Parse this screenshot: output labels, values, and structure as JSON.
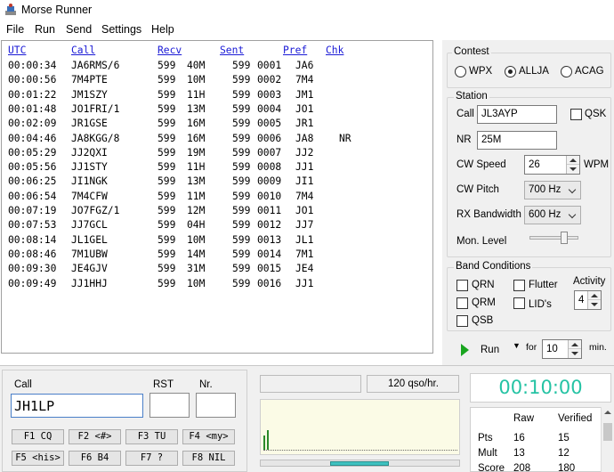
{
  "window": {
    "title": "Morse Runner"
  },
  "menu": [
    "File",
    "Run",
    "Send",
    "Settings",
    "Help"
  ],
  "log": {
    "columns": [
      "UTC",
      "Call",
      "Recv",
      "Sent",
      "Pref",
      "Chk"
    ],
    "rows": [
      {
        "utc": "00:00:34",
        "call": "JA6RMS/6",
        "rst": "599",
        "nr_recv": "40M",
        "rst_sent": "599",
        "nr_sent": "0001",
        "pref": "JA6",
        "chk": ""
      },
      {
        "utc": "00:00:56",
        "call": "7M4PTE",
        "rst": "599",
        "nr_recv": "10M",
        "rst_sent": "599",
        "nr_sent": "0002",
        "pref": "7M4",
        "chk": ""
      },
      {
        "utc": "00:01:22",
        "call": "JM1SZY",
        "rst": "599",
        "nr_recv": "11H",
        "rst_sent": "599",
        "nr_sent": "0003",
        "pref": "JM1",
        "chk": ""
      },
      {
        "utc": "00:01:48",
        "call": "JO1FRI/1",
        "rst": "599",
        "nr_recv": "13M",
        "rst_sent": "599",
        "nr_sent": "0004",
        "pref": "JO1",
        "chk": ""
      },
      {
        "utc": "00:02:09",
        "call": "JR1GSE",
        "rst": "599",
        "nr_recv": "16M",
        "rst_sent": "599",
        "nr_sent": "0005",
        "pref": "JR1",
        "chk": ""
      },
      {
        "utc": "00:04:46",
        "call": "JA8KGG/8",
        "rst": "599",
        "nr_recv": "16M",
        "rst_sent": "599",
        "nr_sent": "0006",
        "pref": "JA8",
        "chk": "NR"
      },
      {
        "utc": "00:05:29",
        "call": "JJ2QXI",
        "rst": "599",
        "nr_recv": "19M",
        "rst_sent": "599",
        "nr_sent": "0007",
        "pref": "JJ2",
        "chk": ""
      },
      {
        "utc": "00:05:56",
        "call": "JJ1STY",
        "rst": "599",
        "nr_recv": "11H",
        "rst_sent": "599",
        "nr_sent": "0008",
        "pref": "JJ1",
        "chk": ""
      },
      {
        "utc": "00:06:25",
        "call": "JI1NGK",
        "rst": "599",
        "nr_recv": "13M",
        "rst_sent": "599",
        "nr_sent": "0009",
        "pref": "JI1",
        "chk": ""
      },
      {
        "utc": "00:06:54",
        "call": "7M4CFW",
        "rst": "599",
        "nr_recv": "11M",
        "rst_sent": "599",
        "nr_sent": "0010",
        "pref": "7M4",
        "chk": ""
      },
      {
        "utc": "00:07:19",
        "call": "JO7FGZ/1",
        "rst": "599",
        "nr_recv": "12M",
        "rst_sent": "599",
        "nr_sent": "0011",
        "pref": "JO1",
        "chk": ""
      },
      {
        "utc": "00:07:53",
        "call": "JJ7GCL",
        "rst": "599",
        "nr_recv": "04H",
        "rst_sent": "599",
        "nr_sent": "0012",
        "pref": "JJ7",
        "chk": ""
      },
      {
        "utc": "00:08:14",
        "call": "JL1GEL",
        "rst": "599",
        "nr_recv": "10M",
        "rst_sent": "599",
        "nr_sent": "0013",
        "pref": "JL1",
        "chk": ""
      },
      {
        "utc": "00:08:46",
        "call": "7M1UBW",
        "rst": "599",
        "nr_recv": "14M",
        "rst_sent": "599",
        "nr_sent": "0014",
        "pref": "7M1",
        "chk": ""
      },
      {
        "utc": "00:09:30",
        "call": "JE4GJV",
        "rst": "599",
        "nr_recv": "31M",
        "rst_sent": "599",
        "nr_sent": "0015",
        "pref": "JE4",
        "chk": ""
      },
      {
        "utc": "00:09:49",
        "call": "JJ1HHJ",
        "rst": "599",
        "nr_recv": "10M",
        "rst_sent": "599",
        "nr_sent": "0016",
        "pref": "JJ1",
        "chk": ""
      }
    ]
  },
  "contest": {
    "title": "Contest",
    "options": [
      "WPX",
      "ALLJA",
      "ACAG"
    ],
    "selected": "ALLJA"
  },
  "station": {
    "title": "Station",
    "call_label": "Call",
    "call_value": "JL3AYP",
    "qsk_label": "QSK",
    "nr_label": "NR",
    "nr_value": "25M",
    "cw_speed_label": "CW Speed",
    "cw_speed_value": "26",
    "cw_speed_unit": "WPM",
    "cw_pitch_label": "CW Pitch",
    "cw_pitch_value": "700 Hz",
    "rx_bw_label": "RX Bandwidth",
    "rx_bw_value": "600 Hz",
    "mon_level_label": "Mon. Level"
  },
  "band": {
    "title": "Band Conditions",
    "qrn": "QRN",
    "qrm": "QRM",
    "qsb": "QSB",
    "flutter": "Flutter",
    "lids": "LID's",
    "activity_label": "Activity",
    "activity_value": "4"
  },
  "run": {
    "label": "Run",
    "for_label": "for",
    "minutes": "10",
    "min_label": "min."
  },
  "entry": {
    "call_label": "Call",
    "call_value": "JH1LP",
    "rst_label": "RST",
    "nr_label": "Nr."
  },
  "fkeys": [
    "F1 CQ",
    "F2 <#>",
    "F3 TU",
    "F4 <my>",
    "F5 <his>",
    "F6 B4",
    "F7 ?",
    "F8 NIL"
  ],
  "rate": "120 qso/hr.",
  "clock": "00:10:00",
  "score": {
    "headers": [
      "Raw",
      "Verified"
    ],
    "rows": [
      {
        "label": "Pts",
        "raw": "16",
        "verified": "15"
      },
      {
        "label": "Mult",
        "raw": "13",
        "verified": "12"
      },
      {
        "label": "Score",
        "raw": "208",
        "verified": "180"
      }
    ]
  }
}
